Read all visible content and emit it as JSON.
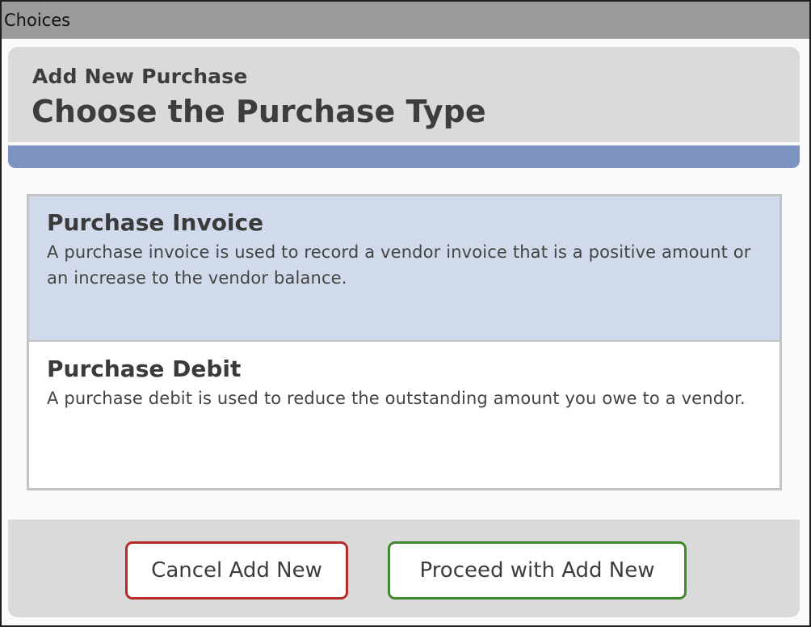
{
  "window": {
    "title": "Choices"
  },
  "header": {
    "subtitle": "Add New Purchase",
    "title": "Choose the Purchase Type"
  },
  "choices": [
    {
      "name": "Purchase Invoice",
      "description": "A purchase invoice is used to record a vendor invoice that is a positive amount or an increase to the vendor balance.",
      "selected": true
    },
    {
      "name": "Purchase Debit",
      "description": "A purchase debit is used to reduce the outstanding amount you owe to a vendor.",
      "selected": false
    }
  ],
  "footer": {
    "cancel_label": "Cancel Add New",
    "proceed_label": "Proceed with Add New"
  },
  "colors": {
    "accent_bar": "#7c93c2",
    "selected_row": "#d1daea",
    "cancel_border": "#b52b26",
    "proceed_border": "#3f8a2f"
  }
}
